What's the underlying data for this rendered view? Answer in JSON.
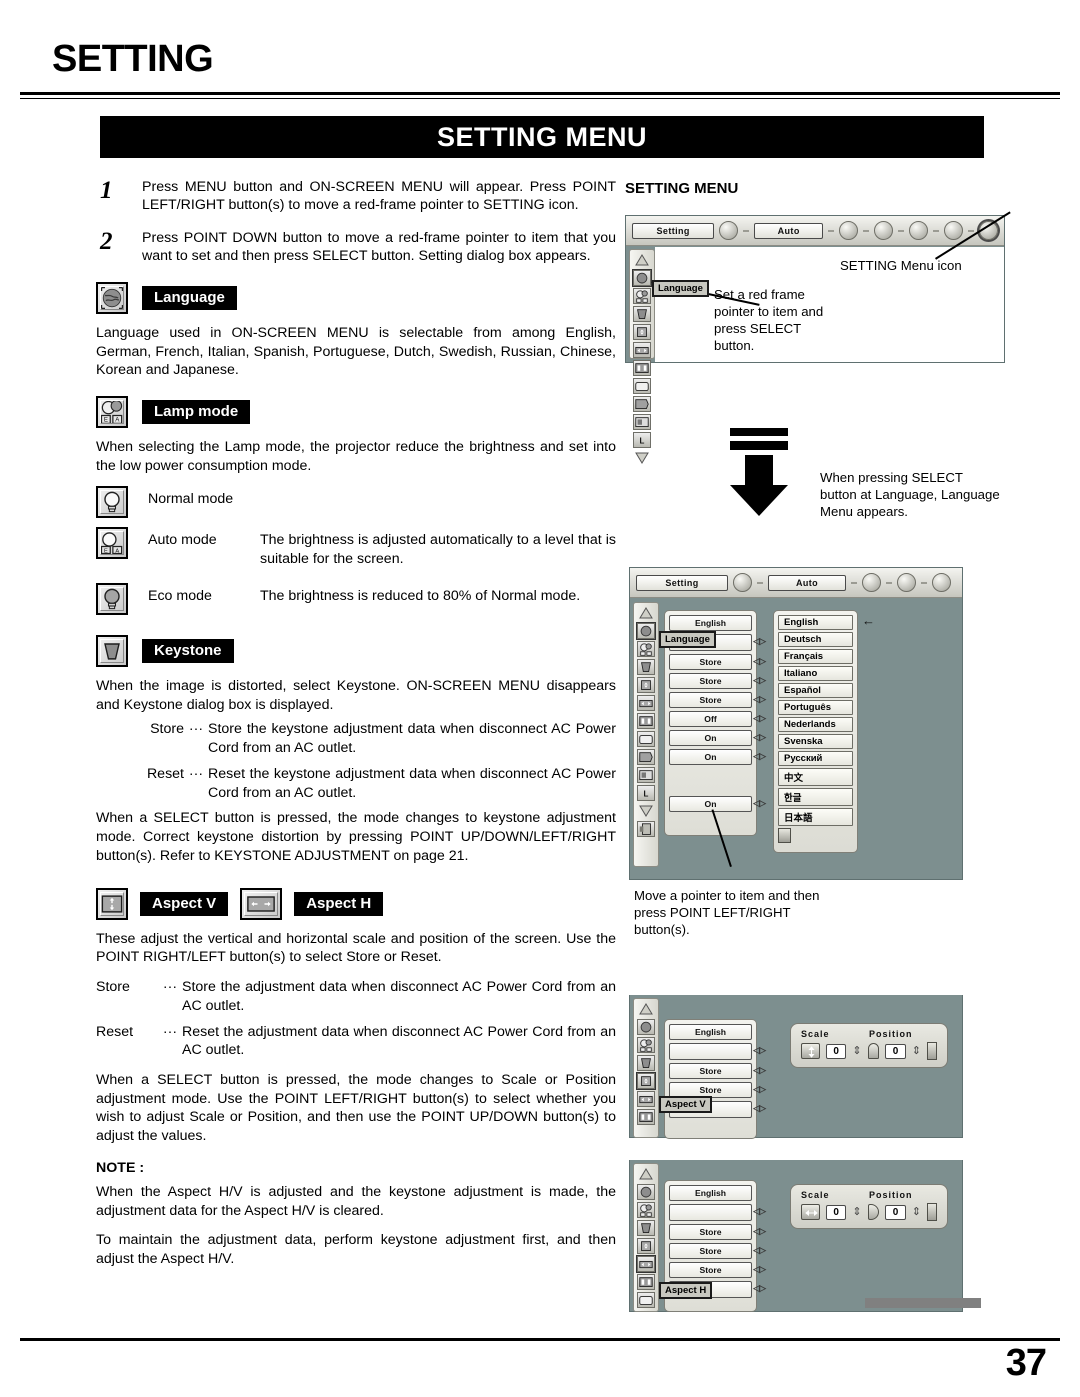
{
  "header": {
    "title": "SETTING",
    "banner": "SETTING MENU"
  },
  "steps": [
    {
      "num": "1",
      "text": "Press MENU button and ON-SCREEN MENU will appear.  Press POINT LEFT/RIGHT button(s) to move a red-frame pointer to SETTING icon."
    },
    {
      "num": "2",
      "text": "Press POINT DOWN button to move a red-frame pointer to item that you want to set and then press SELECT button.  Setting dialog box appears."
    }
  ],
  "sections": {
    "language": {
      "label": "Language",
      "icon": "globe-icon",
      "body": "Language used in ON-SCREEN MENU is selectable from among English, German, French, Italian, Spanish, Portuguese, Dutch, Swedish, Russian, Chinese, Korean and Japanese."
    },
    "lamp_mode": {
      "label": "Lamp mode",
      "icon": "lamp-auto-icon",
      "body": "When selecting the Lamp mode, the projector reduce the brightness and set into the low power consumption mode.",
      "modes": [
        {
          "name": "Normal mode",
          "icon": "lamp-normal-icon",
          "desc": ""
        },
        {
          "name": "Auto mode",
          "icon": "lamp-auto-icon",
          "desc": "The brightness is adjusted automatically to a level that is suitable for the screen."
        },
        {
          "name": "Eco mode",
          "icon": "lamp-eco-icon",
          "desc": "The brightness is reduced to 80% of Normal mode."
        }
      ]
    },
    "keystone": {
      "label": "Keystone",
      "icon": "keystone-icon",
      "body": "When the image is distorted, select Keystone.  ON-SCREEN MENU disappears and Keystone dialog box is displayed.",
      "defs": [
        {
          "term": "Store",
          "dots": "···",
          "desc": "Store the keystone adjustment data when disconnect AC Power Cord from an AC outlet."
        },
        {
          "term": "Reset",
          "dots": "···",
          "desc": "Reset the keystone adjustment data when disconnect AC Power Cord from an AC outlet."
        }
      ],
      "footer": "When a SELECT button is pressed, the mode changes to keystone adjustment mode. Correct keystone distortion by pressing POINT UP/DOWN/LEFT/RIGHT  button(s).  Refer  to  KEYSTONE ADJUSTMENT on page 21."
    },
    "aspect": {
      "label_v": "Aspect V",
      "label_h": "Aspect H",
      "icon_v": "aspect-v-icon",
      "icon_h": "aspect-h-icon",
      "body": "These adjust the vertical and horizontal scale and position of the screen. Use the POINT RIGHT/LEFT button(s) to select Store or Reset.",
      "defs": [
        {
          "term": "Store",
          "dots": "···",
          "desc": "Store the adjustment data when disconnect AC Power Cord from an AC outlet."
        },
        {
          "term": "Reset",
          "dots": "···",
          "desc": "Reset the adjustment data when disconnect AC Power Cord from an AC outlet."
        }
      ],
      "footer": "When a SELECT button is pressed, the mode changes to Scale or Position adjustment mode. Use the POINT LEFT/RIGHT button(s) to select whether you wish to adjust Scale or Position, and then use the POINT UP/DOWN button(s) to adjust the values."
    },
    "note": {
      "title": "NOTE :",
      "p1": "When the Aspect H/V is adjusted and the keystone adjustment is made, the adjustment data for the Aspect H/V is cleared.",
      "p2": "To maintain the adjustment data, perform keystone adjustment first, and then adjust the Aspect H/V."
    }
  },
  "figures": {
    "fig1": {
      "title": "SETTING MENU",
      "menubar": {
        "setting_btn": "Setting",
        "auto_btn": "Auto"
      },
      "red_frame_label": "Language",
      "callout_icon": "SETTING Menu icon",
      "callout_pointer": "Set a red frame pointer to item and press SELECT button."
    },
    "arrow_caption": "When pressing SELECT button at Language, Language Menu appears.",
    "fig2": {
      "menubar": {
        "setting_btn": "Setting",
        "auto_btn": "Auto"
      },
      "red_frame_label": "Language",
      "fields": [
        "English",
        "",
        "Store",
        "Store",
        "Store",
        "Off",
        "On",
        "On",
        "On"
      ],
      "languages": [
        "English",
        "Deutsch",
        "Français",
        "Italiano",
        "Español",
        "Português",
        "Nederlands",
        "Svenska",
        "Русский",
        "中文",
        "한글",
        "日本語"
      ],
      "selected_language": "English",
      "callout": "Move a pointer to item and then press POINT LEFT/RIGHT button(s)."
    },
    "fig3": {
      "red_frame_label": "Aspect V",
      "fields": [
        "English",
        "",
        "Store",
        "Store",
        ""
      ],
      "dialog": {
        "scale_label": "Scale",
        "position_label": "Position",
        "scale_value": "0",
        "position_value": "0"
      }
    },
    "fig4": {
      "red_frame_label": "Aspect H",
      "fields": [
        "English",
        "",
        "Store",
        "Store",
        "Store",
        ""
      ],
      "dialog": {
        "scale_label": "Scale",
        "position_label": "Position",
        "scale_value": "0",
        "position_value": "0"
      }
    }
  },
  "footer": {
    "page_number": "37"
  }
}
